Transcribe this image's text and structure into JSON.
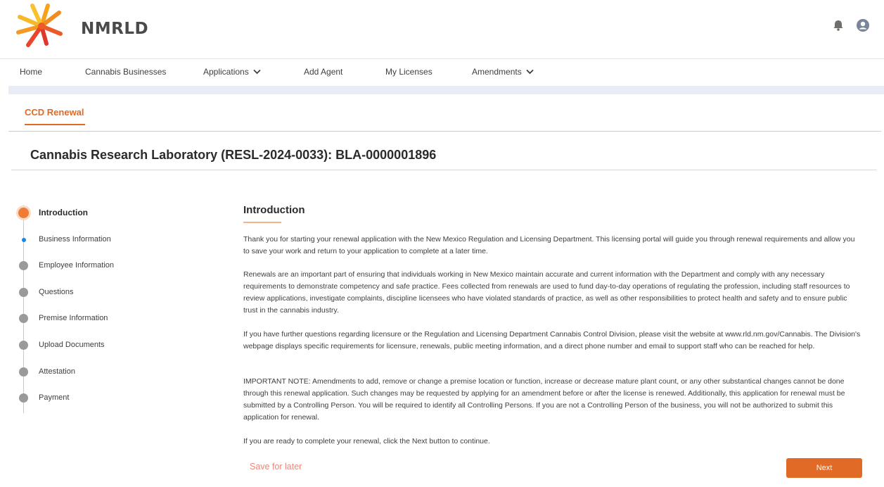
{
  "brand": {
    "name": "NMRLD",
    "accent": "#e06a26"
  },
  "header": {
    "icons": [
      "bell-icon",
      "user-avatar-icon"
    ]
  },
  "nav": {
    "items": [
      {
        "label": "Home",
        "has_dropdown": false
      },
      {
        "label": "Cannabis Businesses",
        "has_dropdown": false
      },
      {
        "label": "Applications",
        "has_dropdown": true
      },
      {
        "label": "Add Agent",
        "has_dropdown": false
      },
      {
        "label": "My Licenses",
        "has_dropdown": false
      },
      {
        "label": "Amendments",
        "has_dropdown": true
      }
    ]
  },
  "tab": {
    "label": "CCD Renewal"
  },
  "page": {
    "title": "Cannabis Research Laboratory (RESL-2024-0033): BLA-0000001896"
  },
  "steps": {
    "items": [
      {
        "label": "Introduction",
        "state": "current"
      },
      {
        "label": "Business Information",
        "state": "next"
      },
      {
        "label": "Employee Information",
        "state": "pending"
      },
      {
        "label": "Questions",
        "state": "pending"
      },
      {
        "label": "Premise Information",
        "state": "pending"
      },
      {
        "label": "Upload Documents",
        "state": "pending"
      },
      {
        "label": "Attestation",
        "state": "pending"
      },
      {
        "label": "Payment",
        "state": "pending"
      }
    ]
  },
  "content": {
    "heading": "Introduction",
    "paragraphs": [
      "Thank you for starting your renewal application with the New Mexico Regulation and Licensing Department. This licensing portal will guide you through renewal requirements and allow you to save your work and return to your application to complete at a later time.",
      "Renewals are an important part of ensuring that individuals working in New Mexico maintain accurate and current information with the Department and comply with any necessary requirements to demonstrate competency and safe practice. Fees collected from renewals are used to fund day-to-day operations of regulating the profession, including staff resources to review applications, investigate complaints, discipline licensees who have violated standards of practice, as well as other responsibilities to protect health and safety and to ensure public trust in the cannabis industry.",
      "If you have further questions regarding licensure or the Regulation and Licensing Department Cannabis Control Division, please visit the website at www.rld.nm.gov/Cannabis. The Division's webpage displays specific requirements for licensure, renewals, public meeting information, and a direct phone number and email to support staff who can be reached for help.",
      "IMPORTANT NOTE: Amendments to add, remove or change a premise location or function, increase or decrease mature plant count, or any other substantical changes cannot be done through this renewal application. Such changes may be requested by applying for an amendment before or after the license is renewed. Additionally, this application for renewal must be submitted by a Controlling Person. You will be required to identify all Controlling Persons. If you are not a Controlling Person of the business, you will not be authorized to submit this application for renewal.",
      "If you are ready to complete your renewal, click the Next button to continue."
    ]
  },
  "actions": {
    "save_label": "Save for later",
    "next_label": "Next"
  }
}
